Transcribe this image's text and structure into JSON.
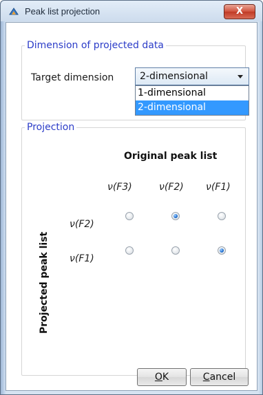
{
  "window": {
    "title": "Peak list projection",
    "close_glyph": "X",
    "app_icon": "app-icon"
  },
  "dimension_panel": {
    "legend": "Dimension of projected data",
    "target_label": "Target dimension",
    "selected_value": "2-dimensional",
    "options": [
      "1-dimensional",
      "2-dimensional"
    ],
    "highlighted_option": "2-dimensional"
  },
  "projection_panel": {
    "legend": "Projection",
    "original_label": "Original peak list",
    "projected_label": "Projected peak list",
    "columns": [
      "ν(F3)",
      "ν(F2)",
      "ν(F1)"
    ],
    "rows": [
      {
        "label": "ν(F2)",
        "selected": [
          false,
          true,
          false
        ]
      },
      {
        "label": "ν(F1)",
        "selected": [
          false,
          false,
          true
        ]
      }
    ]
  },
  "buttons": {
    "ok_mnemonic": "O",
    "ok_rest": "K",
    "cancel_mnemonic": "C",
    "cancel_rest": "ancel"
  },
  "colors": {
    "legend_text": "#2b3cc8",
    "dropdown_highlight": "#3399ff",
    "close_button": "#c9452f"
  }
}
